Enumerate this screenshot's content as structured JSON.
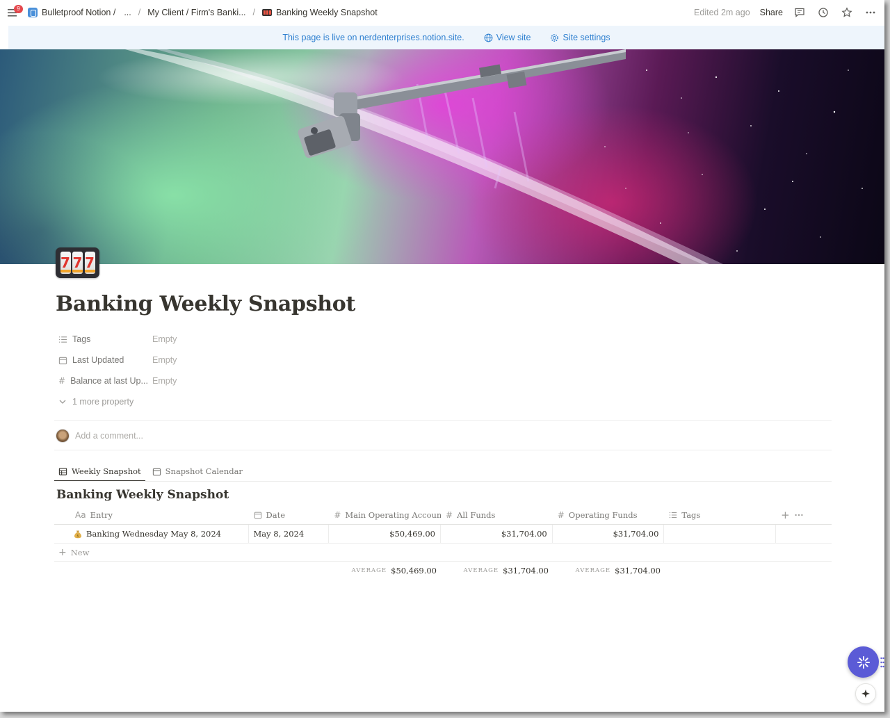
{
  "topbar": {
    "notification_count": "9",
    "breadcrumbs": [
      {
        "label": "Bulletproof Notion /",
        "icon": "database-icon"
      },
      {
        "label": "..."
      },
      {
        "label": "My Client / Firm's Banki..."
      },
      {
        "label": "Banking Weekly Snapshot",
        "icon": "slot-machine-icon"
      }
    ],
    "separators": [
      "/",
      "/"
    ],
    "edited": "Edited 2m ago",
    "share": "Share"
  },
  "banner": {
    "message": "This page is live on nerdenterprises.notion.site.",
    "view_site": "View site",
    "site_settings": "Site settings",
    "color": "#2f80d0"
  },
  "page": {
    "icon": "slot-machine-icon",
    "icon_reels": [
      "7",
      "7",
      "7"
    ],
    "title": "Banking Weekly Snapshot"
  },
  "properties": [
    {
      "name": "Tags",
      "value": "Empty",
      "icon": "list-icon"
    },
    {
      "name": "Last Updated",
      "value": "Empty",
      "icon": "calendar-icon"
    },
    {
      "name": "Balance at last Up...",
      "value": "Empty",
      "icon": "number-icon"
    }
  ],
  "more_properties": "1 more property",
  "comment": {
    "placeholder": "Add a comment..."
  },
  "tabs": [
    {
      "label": "Weekly Snapshot",
      "icon": "table-icon",
      "active": true
    },
    {
      "label": "Snapshot Calendar",
      "icon": "calendar-icon",
      "active": false
    }
  ],
  "database": {
    "title": "Banking Weekly Snapshot",
    "columns": [
      {
        "label": "Entry",
        "icon": "Aa"
      },
      {
        "label": "Date",
        "icon": "calendar-icon"
      },
      {
        "label": "Main Operating Account",
        "icon": "#"
      },
      {
        "label": "All Funds",
        "icon": "#"
      },
      {
        "label": "Operating Funds",
        "icon": "#"
      },
      {
        "label": "Tags",
        "icon": "list-icon"
      }
    ],
    "rows": [
      {
        "entry": "Banking Wednesday May 8, 2024",
        "entry_icon": "money-bag-icon",
        "date": "May 8, 2024",
        "main_operating": "$50,469.00",
        "all_funds": "$31,704.00",
        "operating_funds": "$31,704.00",
        "tags": ""
      }
    ],
    "new_label": "New",
    "aggregates": {
      "label": "AVERAGE",
      "main_operating": "$50,469.00",
      "all_funds": "$31,704.00",
      "operating_funds": "$31,704.00"
    }
  },
  "accent_color": "#5b5bd6"
}
